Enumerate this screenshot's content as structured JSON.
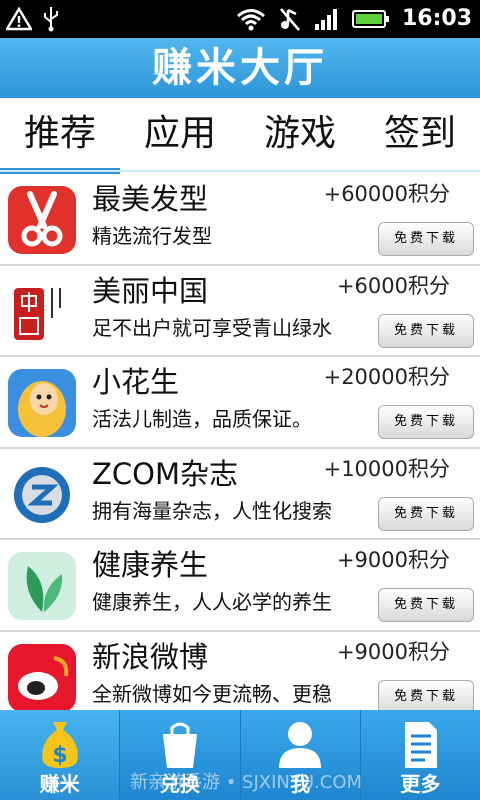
{
  "status_bar": {
    "time": "16:03"
  },
  "title": "赚米大厅",
  "tabs": [
    {
      "label": "推荐",
      "active": true
    },
    {
      "label": "应用",
      "active": false
    },
    {
      "label": "游戏",
      "active": false
    },
    {
      "label": "签到",
      "active": false
    }
  ],
  "apps": [
    {
      "name": "最美发型",
      "desc": "精选流行发型",
      "points": "+60000积分",
      "button": "免费下载",
      "icon": "scissors-icon"
    },
    {
      "name": "美丽中国",
      "desc": "足不出户就可享受青山绿水",
      "points": "+6000积分",
      "button": "免费下载",
      "icon": "beautiful-china-icon"
    },
    {
      "name": "小花生",
      "desc": "活法儿制造，品质保证。",
      "points": "+20000积分",
      "button": "免费下载",
      "icon": "peanut-character-icon"
    },
    {
      "name": "ZCOM杂志",
      "desc": "拥有海量杂志，人性化搜索",
      "points": "+10000积分",
      "button": "免费下载",
      "icon": "zcom-logo-icon"
    },
    {
      "name": "健康养生",
      "desc": "健康养生，人人必学的养生",
      "points": "+9000积分",
      "button": "免费下载",
      "icon": "leaf-icon"
    },
    {
      "name": "新浪微博",
      "desc": "全新微博如今更流畅、更稳",
      "points": "+9000积分",
      "button": "免费下载",
      "icon": "weibo-icon"
    }
  ],
  "bottom_nav": [
    {
      "label": "赚米",
      "icon": "money-bag-icon",
      "active": true
    },
    {
      "label": "兑换",
      "icon": "shopping-bag-icon",
      "active": false
    },
    {
      "label": "我",
      "icon": "user-icon",
      "active": false
    },
    {
      "label": "更多",
      "icon": "document-icon",
      "active": false
    }
  ],
  "watermark": "新亲游手游 • SJXINYU.COM",
  "colors": {
    "accent": "#2e95d8",
    "statusbar": "#000000"
  }
}
